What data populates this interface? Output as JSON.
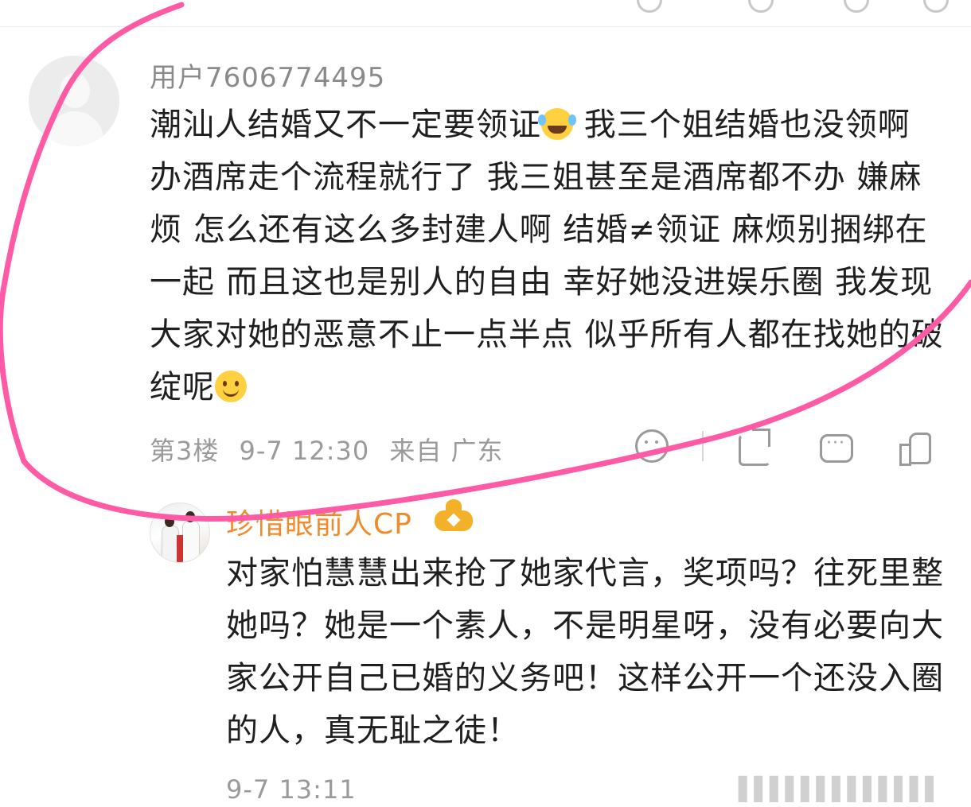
{
  "comment": {
    "username": "用户7606774495",
    "text_before_emoji": "潮汕人结婚又不一定要领证",
    "emoji_1": "laugh-cry-emoji",
    "text_middle": " 我三个姐结婚也没领啊 办酒席走个流程就行了 我三姐甚至是酒席都不办 嫌麻烦 怎么还有这么多封建人啊 结婚≠领证 麻烦别捆绑在一起 而且这也是别人的自由 幸好她没进娱乐圈 我发现大家对她的恶意不止一点半点 似乎所有人都在找她的破绽呢",
    "emoji_2": "smile-emoji",
    "floor": "第3楼",
    "time": "9-7 12:30",
    "location": "来自 广东"
  },
  "reply": {
    "username": "珍惜眼前人CP",
    "badge_icon": "crown-vip-icon",
    "text": " 对家怕慧慧出来抢了她家代言，奖项吗？往死里整她吗？她是一个素人，不是明星呀，没有必要向大家公开自己已婚的义务吧！这样公开一个还没入圈的人，真无耻之徒！",
    "time": "9-7 13:11"
  },
  "colors": {
    "annotation": "#ff5aa5",
    "reply_name": "#f08a2a",
    "meta": "#9a9a9a"
  }
}
